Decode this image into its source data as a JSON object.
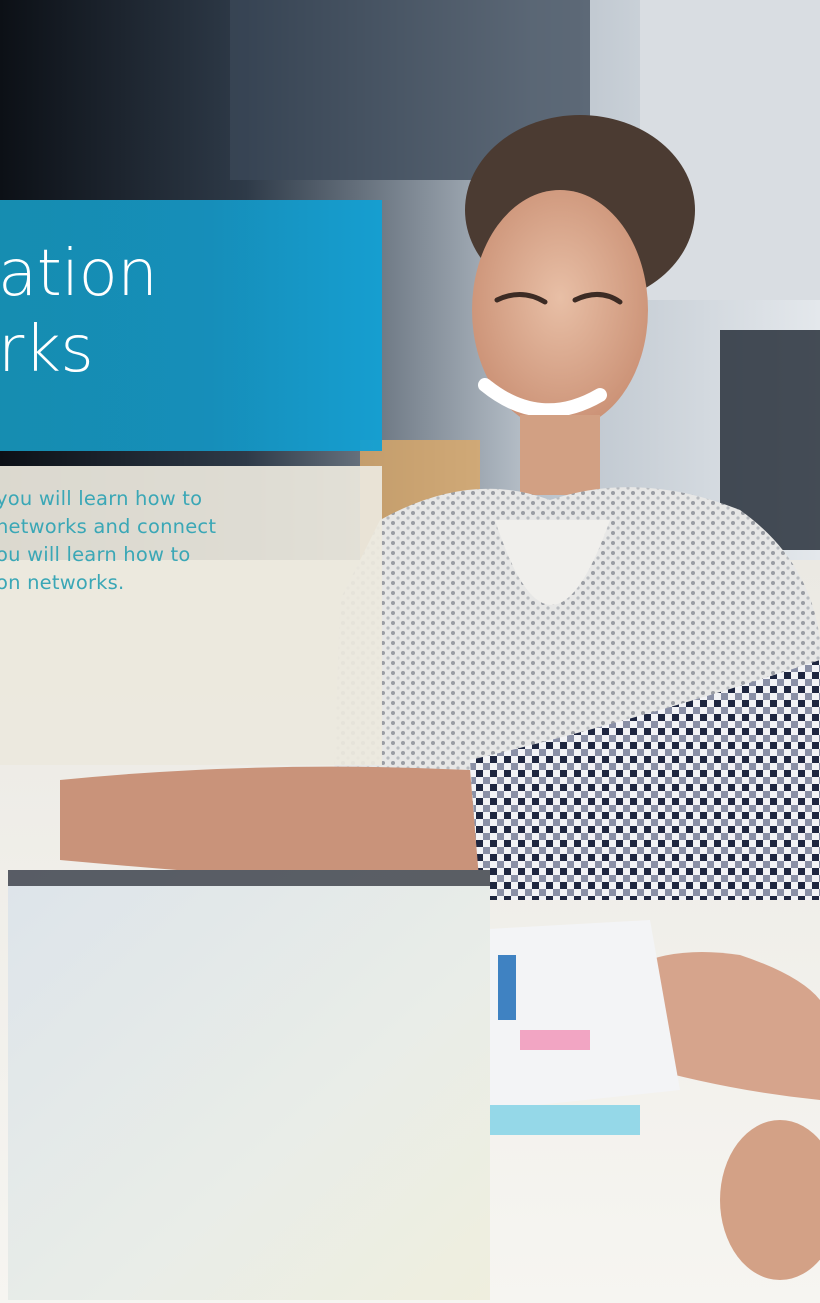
{
  "title": {
    "line1": "ation",
    "line2": "rks"
  },
  "description": {
    "lines": [
      " you will learn how to",
      "networks and connect",
      "ou will learn how to",
      "on networks."
    ]
  },
  "photo": {
    "subject": "office-collaboration-photo",
    "colors": {
      "accent_blue": "#1597c4",
      "panel_beige": "#ece8de",
      "text_teal": "#3aa7b6"
    }
  }
}
